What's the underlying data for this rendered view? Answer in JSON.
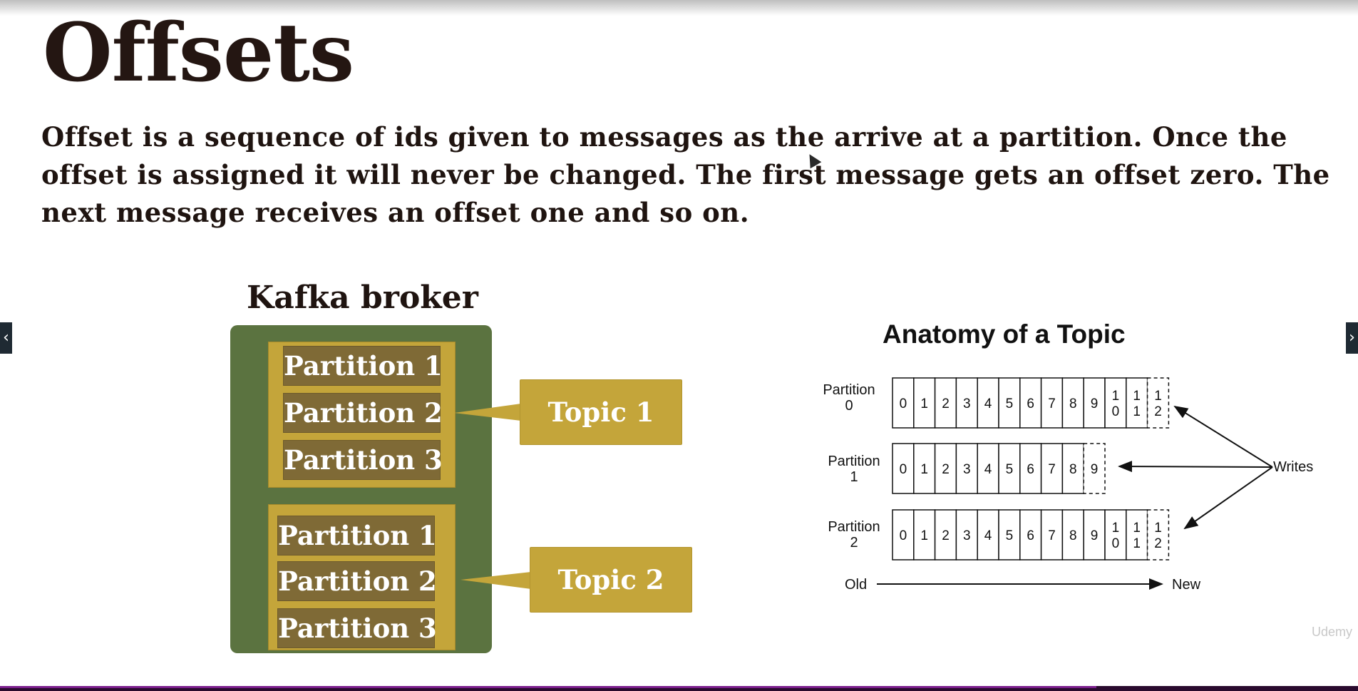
{
  "slide": {
    "title": "Offsets",
    "body": "Offset is a sequence of ids given to messages as the arrive at a partition. Once the offset is assigned it will never be changed. The first message gets an offset zero. The next message receives an offset one and so on."
  },
  "navigation": {
    "prev_icon": "chevron-left-icon",
    "prev_glyph": "‹",
    "next_icon": "chevron-right-icon",
    "next_glyph": "›"
  },
  "broker_diagram": {
    "title": "Kafka broker",
    "topics": [
      {
        "label": "Topic 1",
        "partitions": [
          "Partition 1",
          "Partition 2",
          "Partition 3"
        ]
      },
      {
        "label": "Topic 2",
        "partitions": [
          "Partition 1",
          "Partition 2",
          "Partition 3"
        ]
      }
    ],
    "colors": {
      "broker": "#5b7340",
      "topic": "#c4a53a",
      "partition": "#7f6a36"
    }
  },
  "topic_anatomy": {
    "title": "Anatomy of a Topic",
    "partitions": [
      {
        "label": [
          "Partition",
          "0"
        ],
        "cells": [
          "0",
          "1",
          "2",
          "3",
          "4",
          "5",
          "6",
          "7",
          "8",
          "9",
          "10",
          "11"
        ],
        "pending": "12"
      },
      {
        "label": [
          "Partition",
          "1"
        ],
        "cells": [
          "0",
          "1",
          "2",
          "3",
          "4",
          "5",
          "6",
          "7",
          "8"
        ],
        "pending": "9"
      },
      {
        "label": [
          "Partition",
          "2"
        ],
        "cells": [
          "0",
          "1",
          "2",
          "3",
          "4",
          "5",
          "6",
          "7",
          "8",
          "9",
          "10",
          "11"
        ],
        "pending": "12"
      }
    ],
    "writes_label": "Writes",
    "old_label": "Old",
    "new_label": "New"
  },
  "watermark": "Udemy"
}
